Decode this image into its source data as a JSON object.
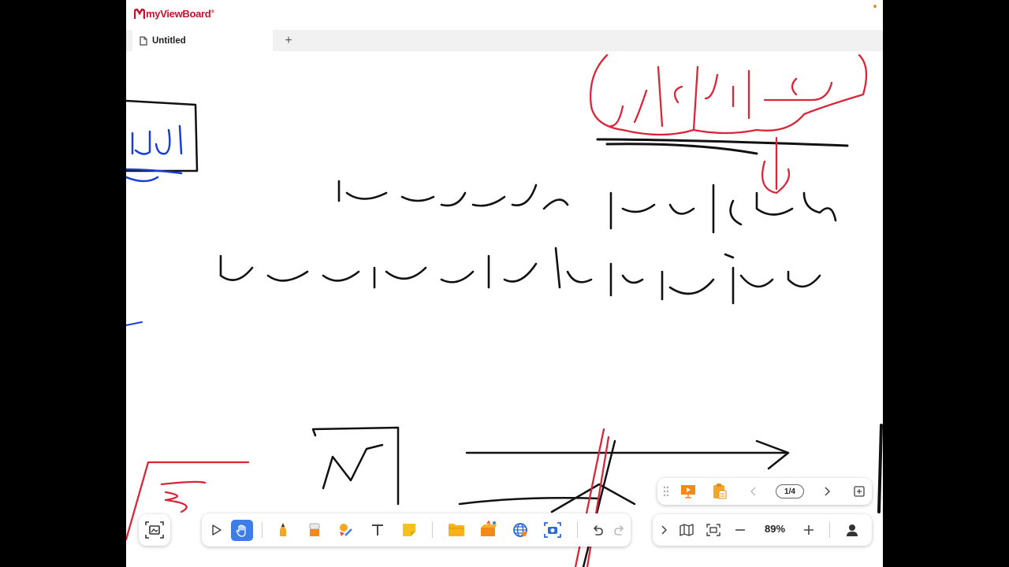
{
  "app": {
    "logo_text": "myViewBoard",
    "logo_reg": "®"
  },
  "tabs": [
    {
      "label": "Untitled",
      "icon": "document-icon"
    }
  ],
  "add_tab_label": "+",
  "pager": {
    "indicator": "1/4"
  },
  "zoom": {
    "value": "89%"
  },
  "toolbar": {
    "tools": [
      {
        "name": "select-tool",
        "icon": "cursor-icon"
      },
      {
        "name": "hand-tool",
        "icon": "hand-icon",
        "active": true
      },
      {
        "name": "pen-tool",
        "icon": "pen-icon"
      },
      {
        "name": "eraser-tool",
        "icon": "eraser-icon"
      },
      {
        "name": "shapes-tool",
        "icon": "shapes-icon"
      },
      {
        "name": "text-tool",
        "icon": "text-icon"
      },
      {
        "name": "sticky-note-tool",
        "icon": "sticky-note-icon"
      },
      {
        "name": "file-tool",
        "icon": "folder-icon"
      },
      {
        "name": "magic-box-tool",
        "icon": "magic-box-icon"
      },
      {
        "name": "web-tool",
        "icon": "globe-icon"
      },
      {
        "name": "screen-capture-tool",
        "icon": "camera-icon"
      },
      {
        "name": "undo",
        "icon": "undo-icon"
      },
      {
        "name": "redo",
        "icon": "redo-icon"
      }
    ]
  },
  "colors": {
    "accent": "#3c7de6",
    "brand": "#c8102e",
    "ink_black": "#111111",
    "ink_red": "#d9263a",
    "ink_blue": "#1b3fd6"
  }
}
